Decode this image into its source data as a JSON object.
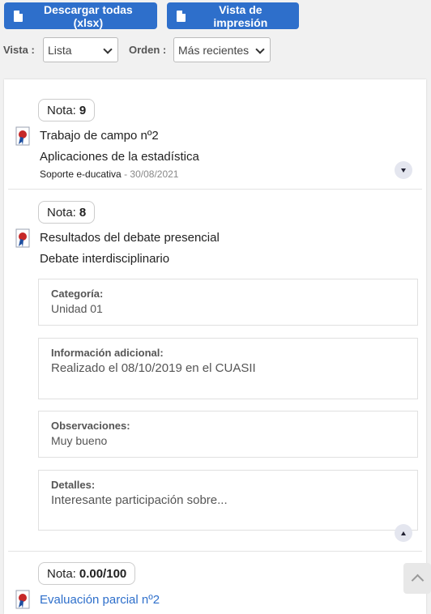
{
  "toolbar": {
    "download_label": "Descargar todas (xlsx)",
    "print_label": "Vista de impresión"
  },
  "filters": {
    "view_label": "Vista :",
    "view_value": "Lista",
    "order_label": "Orden :",
    "order_value": "Más recientes"
  },
  "items": [
    {
      "grade_label": "Nota:",
      "grade": "9",
      "title": "Trabajo de campo nº2",
      "subtitle": "Aplicaciones de la estadística",
      "author": "Soporte e-ducativa",
      "date": "- 30/08/2021"
    },
    {
      "grade_label": "Nota:",
      "grade": "8",
      "title": "Resultados del debate presencial",
      "subtitle": "Debate interdisciplinario",
      "details": [
        {
          "heading": "Categoría:",
          "value": "Unidad 01"
        },
        {
          "heading": "Información adicional:",
          "value": "Realizado el 08/10/2019 en el CUASII"
        },
        {
          "heading": "Observaciones:",
          "value": "Muy bueno"
        },
        {
          "heading": "Detalles:",
          "value": "Interesante participación sobre..."
        }
      ]
    },
    {
      "grade_label": "Nota:",
      "grade": "0.00/100",
      "title": "Evaluación parcial nº2"
    }
  ],
  "icons": {
    "download": "excel-file-icon",
    "print": "pdf-file-icon",
    "medal": "award-ribbon-icon",
    "expand": "chevron-down-icon",
    "collapse": "chevron-up-icon",
    "scroll_top": "arrow-up-icon"
  },
  "colors": {
    "primary": "#2e6fcb",
    "link": "#2e6fcb",
    "medal_red": "#c62828"
  }
}
